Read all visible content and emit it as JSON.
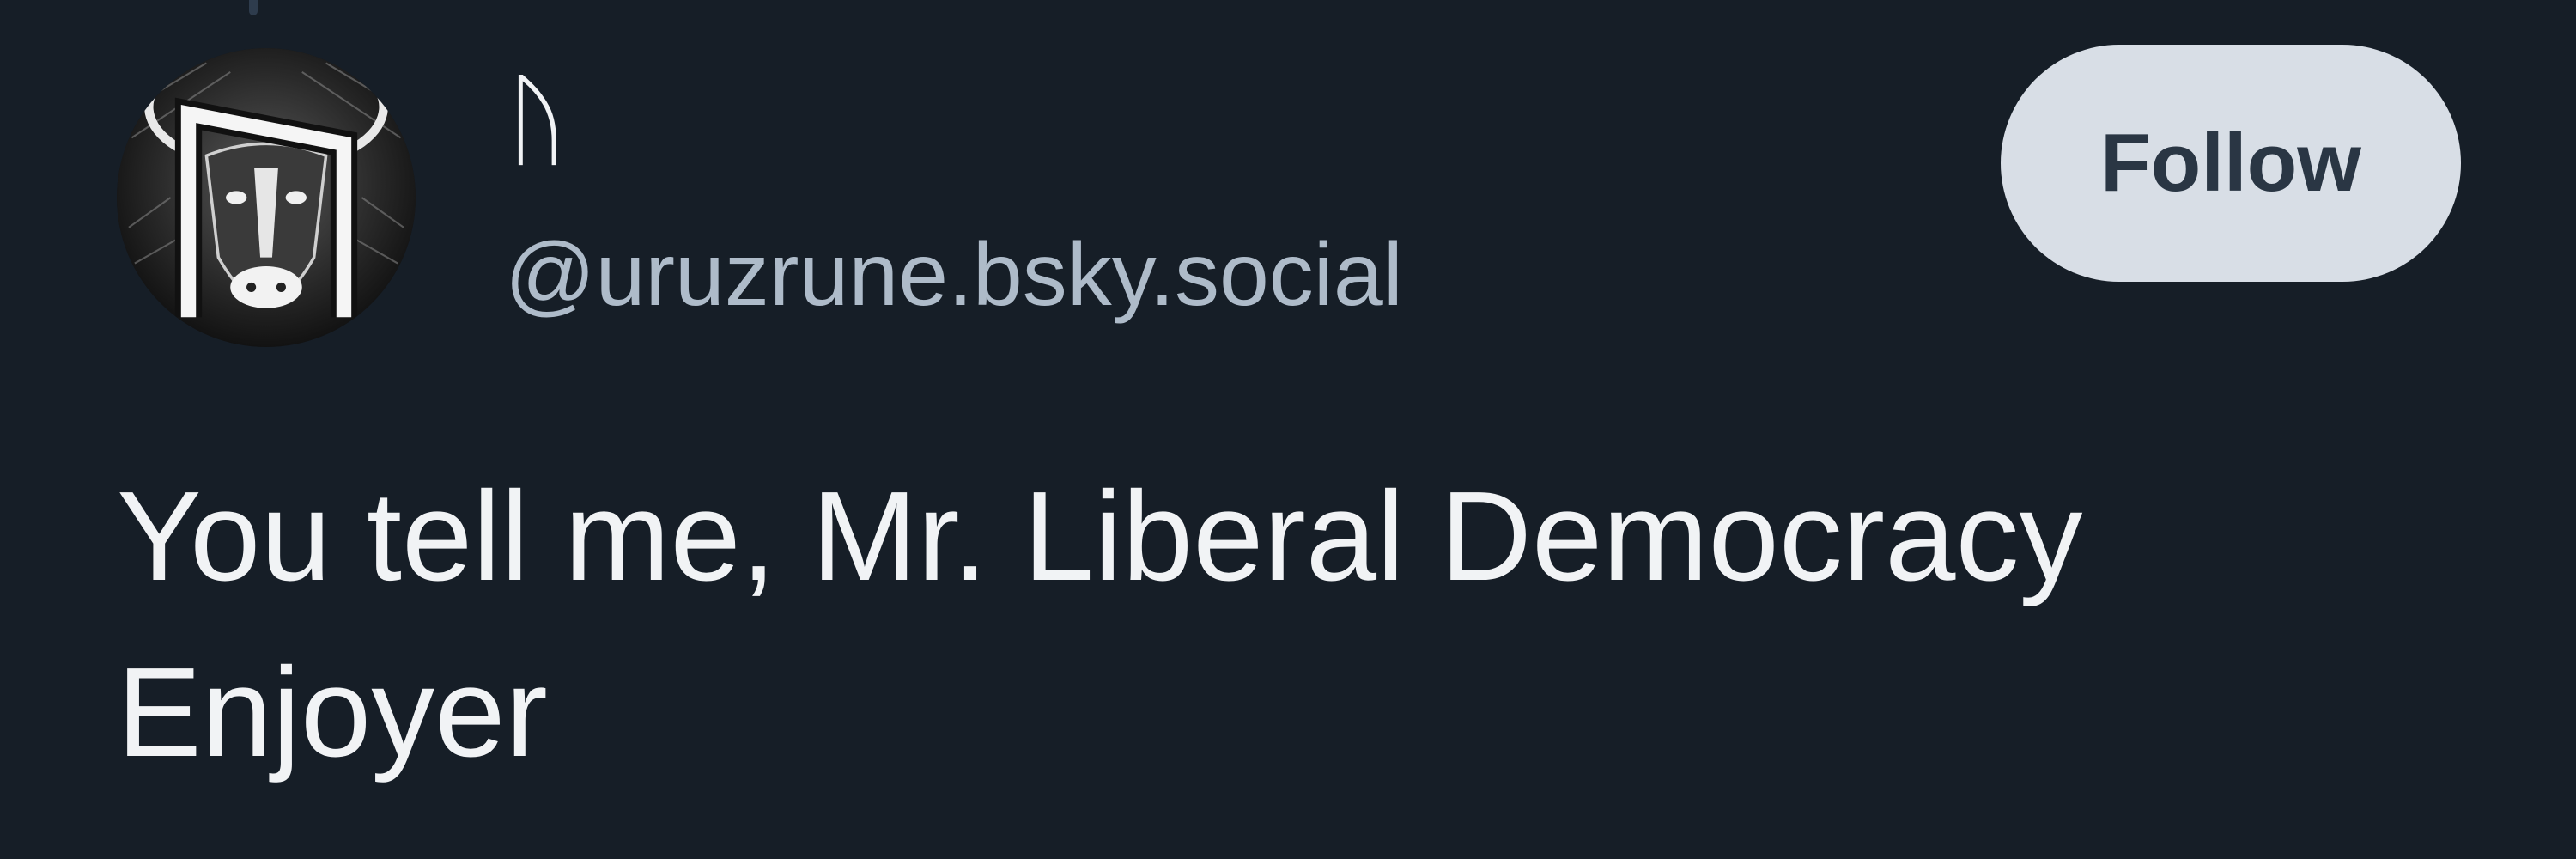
{
  "post": {
    "author": {
      "display_name": "ᚢ",
      "handle": "@uruzrune.bsky.social",
      "avatar_icon": "uruz-rune-bull-avatar"
    },
    "follow_label": "Follow",
    "text": "You tell me, Mr. Liberal Democracy Enjoyer"
  },
  "colors": {
    "background": "#161e27",
    "primary_text": "#f1f3f5",
    "handle_text": "#aebbc9",
    "follow_button_bg": "#d8dee6",
    "follow_button_text": "#2a3644"
  }
}
